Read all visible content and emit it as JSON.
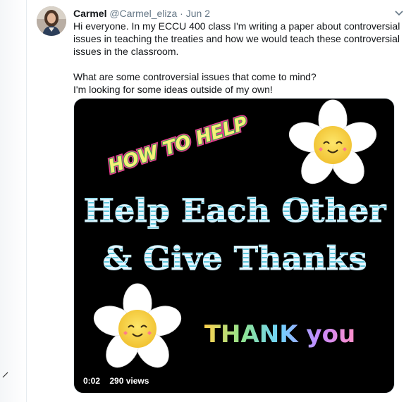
{
  "tweet": {
    "display_name": "Carmel",
    "handle": "@Carmel_eliza",
    "separator": "·",
    "date": "Jun 2",
    "text_line1": "Hi everyone. In my ECCU 400 class I'm writing a paper about controversial",
    "text_line2": "issues in teaching the treaties and how we would teach these controversial",
    "text_line3": "issues in the classroom.",
    "text_line4": "What are some controversial issues that come to mind?",
    "text_line5": "I'm looking for some ideas outside of my own!"
  },
  "video": {
    "banner_text": "HOW TO HELP",
    "title_line1": "Help Each Other",
    "title_line2": "& Give Thanks",
    "thankyou_text": "THANK you",
    "time": "0:02",
    "views": "290 views"
  },
  "colors": {
    "name": "#14171a",
    "secondary": "#657786",
    "media_bg": "#000000",
    "flower_petal": "#ffffff",
    "flower_center": "#f7d23e",
    "title_fill": "#e8f6ff",
    "title_stripe": "#4fc3d9",
    "banner_fill": "#f6f07a",
    "banner_outline": "#3aa84a",
    "banner_glow": "#e83a8f"
  },
  "icons": [
    "avatar-photo",
    "chevron-down-icon",
    "flower-icon",
    "smiley-face-icon"
  ]
}
